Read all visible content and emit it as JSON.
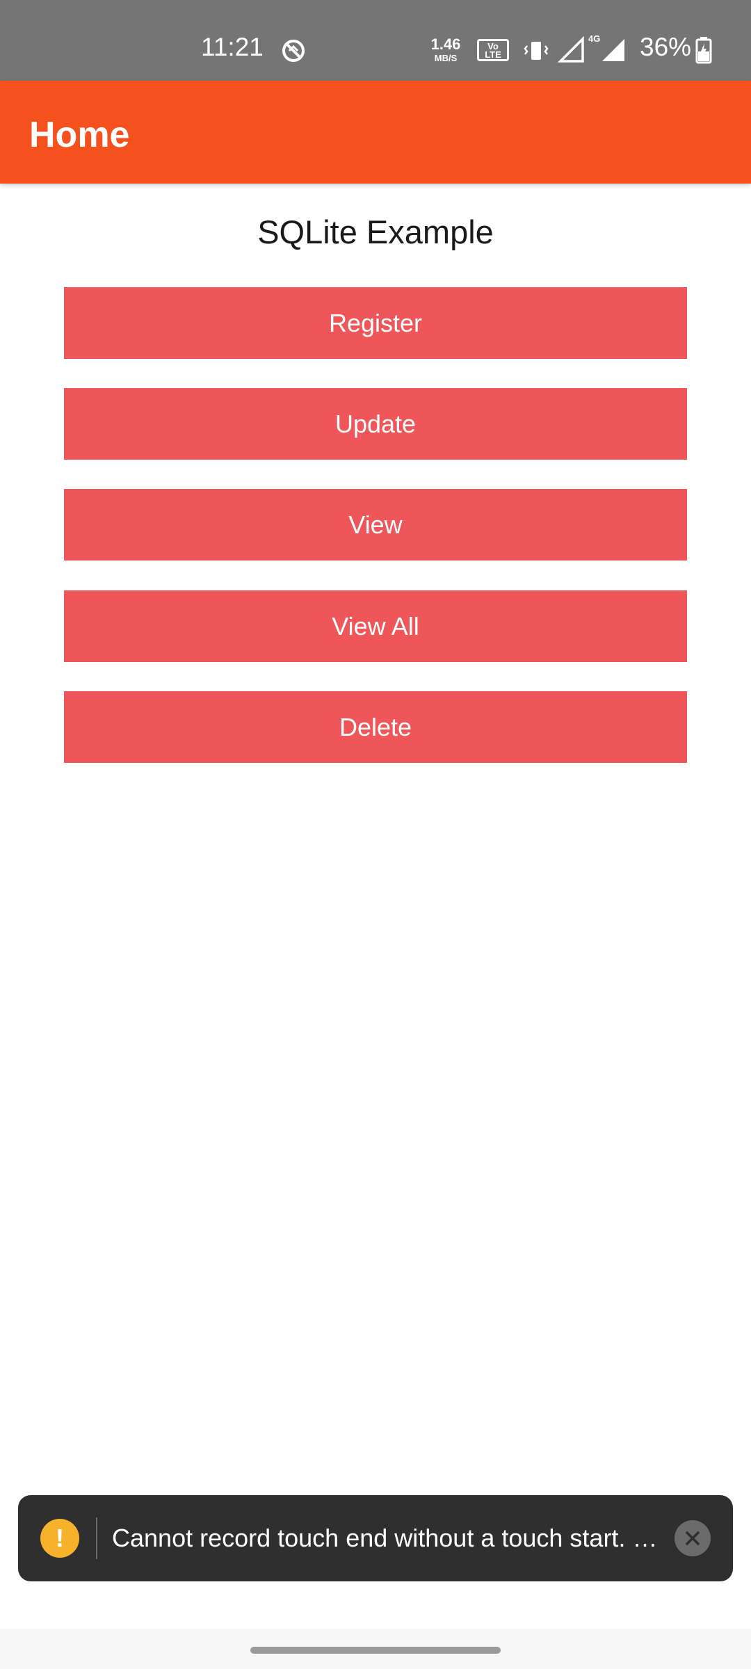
{
  "status_bar": {
    "time": "11:21",
    "network_speed_value": "1.46",
    "network_speed_unit": "MB/S",
    "volte_label": "Vo LTE",
    "network_type": "4G",
    "battery_percent": "36%",
    "icons": [
      "sync-off-icon",
      "volte-icon",
      "vibrate-icon",
      "signal-icon",
      "signal-4g-icon",
      "battery-charging-icon"
    ]
  },
  "app_bar": {
    "title": "Home",
    "color": "#f4511e"
  },
  "main": {
    "title": "SQLite Example",
    "buttons": {
      "register": "Register",
      "update": "Update",
      "view": "View",
      "view_all": "View All",
      "delete": "Delete"
    },
    "button_color": "#ef5659"
  },
  "toast": {
    "icon_glyph": "!",
    "message": "Cannot record touch end without a touch start. …",
    "icon_color": "#f7b22c"
  }
}
